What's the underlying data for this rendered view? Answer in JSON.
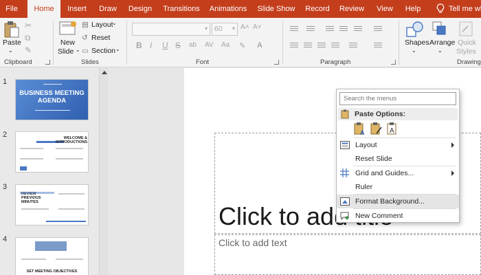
{
  "tabs": [
    {
      "label": "File"
    },
    {
      "label": "Home"
    },
    {
      "label": "Insert"
    },
    {
      "label": "Draw"
    },
    {
      "label": "Design"
    },
    {
      "label": "Transitions"
    },
    {
      "label": "Animations"
    },
    {
      "label": "Slide Show"
    },
    {
      "label": "Record"
    },
    {
      "label": "Review"
    },
    {
      "label": "View"
    },
    {
      "label": "Help"
    }
  ],
  "tell_me": "Tell me wh",
  "ribbon": {
    "clipboard": {
      "paste": "Paste",
      "group": "Clipboard"
    },
    "slides": {
      "new": "New",
      "slide": "Slide",
      "layout": "Layout",
      "reset": "Reset",
      "section": "Section",
      "group": "Slides"
    },
    "font": {
      "size": "60",
      "bold": "B",
      "italic": "I",
      "underline": "U",
      "strike": "S",
      "group": "Font"
    },
    "paragraph": {
      "group": "Paragraph"
    },
    "drawing": {
      "shapes": "Shapes",
      "arrange": "Arrange",
      "quick": "Quick",
      "styles": "Styles",
      "group": "Drawing"
    }
  },
  "slides": [
    {
      "number": "1",
      "title": "BUSINESS MEETING AGENDA"
    },
    {
      "number": "2",
      "title": "WELCOME & INTRODUCTIONS"
    },
    {
      "number": "3",
      "title": "REVIEW PREVIOUS MINUTES"
    },
    {
      "number": "4",
      "title": "SET MEETING OBJECTIVES"
    }
  ],
  "placeholders": {
    "title": "Click to add title",
    "body": "Click to add text"
  },
  "context_menu": {
    "search_placeholder": "Search the menus",
    "paste_options": "Paste Options:",
    "items": [
      {
        "label": "Layout"
      },
      {
        "label": "Reset Slide"
      },
      {
        "label": "Grid and Guides..."
      },
      {
        "label": "Ruler"
      },
      {
        "label": "Format Background..."
      },
      {
        "label": "New Comment"
      }
    ]
  },
  "colors": {
    "accent": "#c43e1c",
    "slide_blue": "#4a78c2"
  }
}
